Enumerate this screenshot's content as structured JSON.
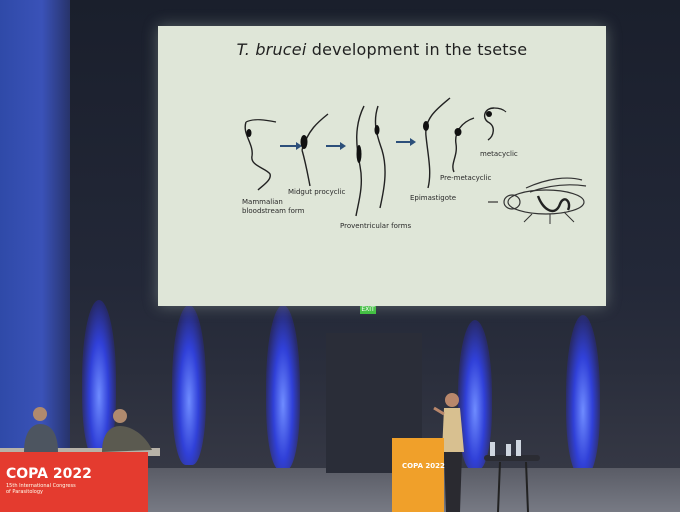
{
  "slide": {
    "title_italic": "T. brucei",
    "title_rest": " development in the tsetse",
    "labels": {
      "mammalian": "Mammalian\nbloodstream form",
      "midgut": "Midgut procyclic",
      "proventricular": "Proventricular forms",
      "epimastigote": "Epimastigote",
      "premetacyclic": "Pre-metacyclic",
      "metacyclic": "metacyclic"
    }
  },
  "venue": {
    "exit_sign": "EXIT",
    "banner_title": "COPA 2022",
    "banner_sub": "15th International Congress\nof Parasitology",
    "podium_text": "COPA 2022"
  }
}
